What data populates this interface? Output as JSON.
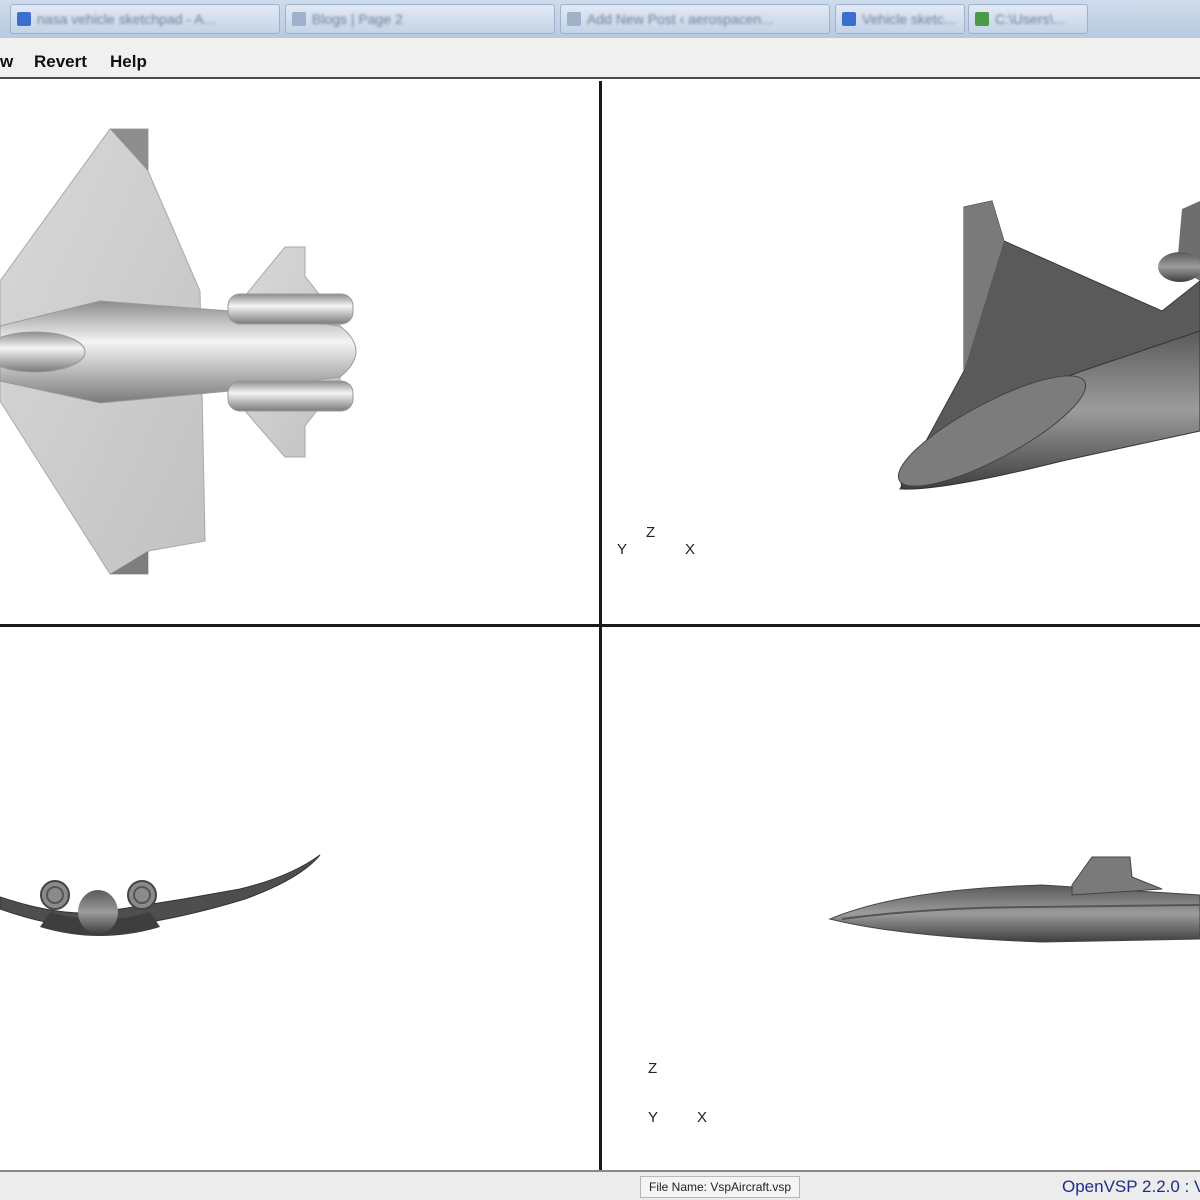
{
  "taskbar": {
    "tabs": [
      {
        "label": "nasa vehicle sketchpad - A..."
      },
      {
        "label": "Blogs | Page 2"
      },
      {
        "label": "Add New Post ‹ aerospacen..."
      },
      {
        "label": "Vehicle sketc..."
      },
      {
        "label": "C:\\Users\\..."
      }
    ]
  },
  "menu": {
    "items": [
      {
        "label": "w"
      },
      {
        "label": "Revert"
      },
      {
        "label": "Help"
      }
    ]
  },
  "views": {
    "perspective": {
      "axes": {
        "y": "Y",
        "z": "Z",
        "x": "X"
      }
    },
    "side": {
      "axes": {
        "z": "Z",
        "y": "Y",
        "x": "X"
      }
    }
  },
  "status": {
    "file_name": "File Name: VspAircraft.vsp",
    "version": "OpenVSP 2.2.0 : V"
  },
  "colors": {
    "model_light": "#d6d6d6",
    "model_dark": "#6e6e6e",
    "divider": "#1a1a1a",
    "version_text": "#1c2f8a"
  }
}
